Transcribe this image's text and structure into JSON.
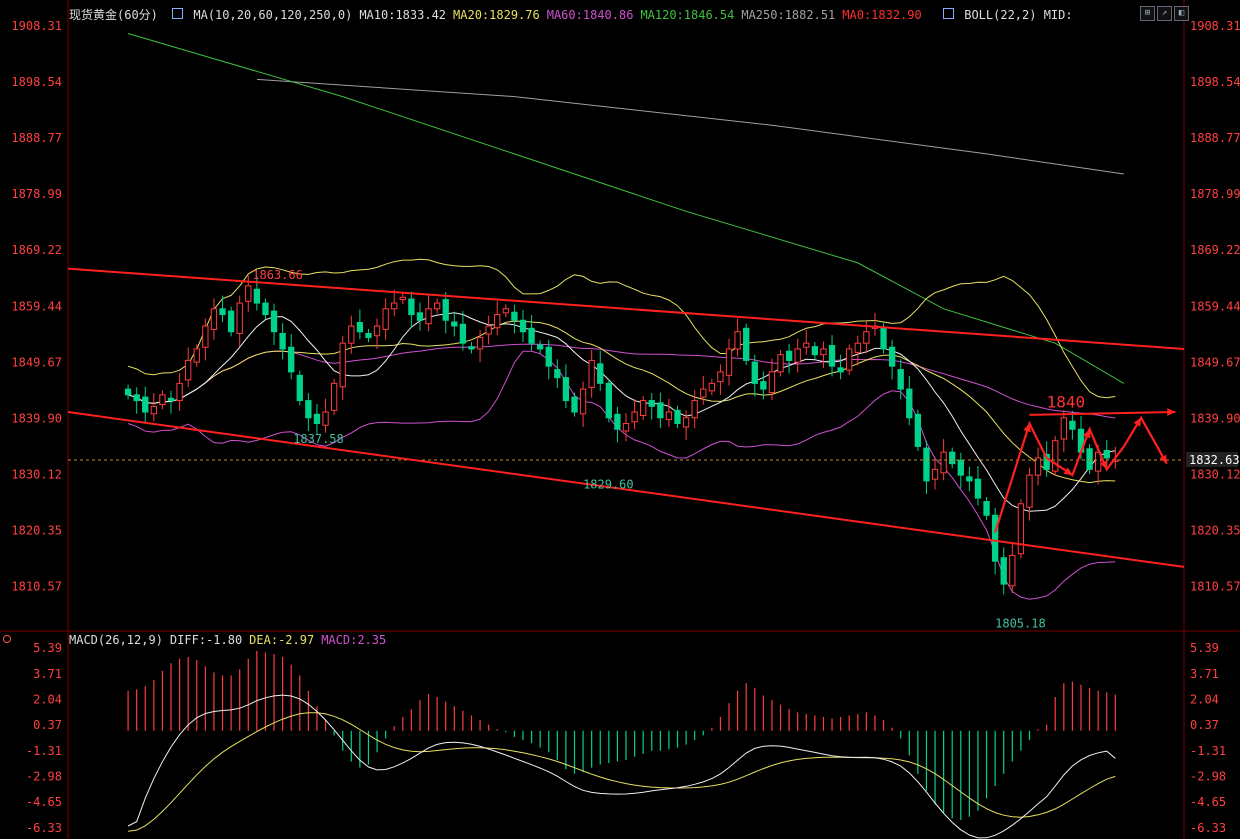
{
  "header": {
    "instrument": "现货黄金(60分)",
    "ma": [
      {
        "text": "MA(10,20,60,120,250,0)",
        "color": "#dddddd"
      },
      {
        "text": "MA10:1833.42",
        "color": "#dddddd"
      },
      {
        "text": "MA20:1829.76",
        "color": "#e8e060"
      },
      {
        "text": "MA60:1840.86",
        "color": "#d050d0"
      },
      {
        "text": "MA120:1846.54",
        "color": "#40c040"
      },
      {
        "text": "MA250:1882.51",
        "color": "#a0a0a0"
      },
      {
        "text": "MA0:1832.90",
        "color": "#ff3030"
      }
    ],
    "boll": "BOLL(22,2) MID:",
    "macd": [
      {
        "text": "MACD(26,12,9)",
        "color": "#dddddd"
      },
      {
        "text": "DIFF:-1.80",
        "color": "#dddddd"
      },
      {
        "text": "DEA:-2.97",
        "color": "#e8e060"
      },
      {
        "text": "MACD:2.35",
        "color": "#d050d0"
      }
    ]
  },
  "icons": {
    "instrument": "chart-icon",
    "boll": "chart-icon",
    "toolbar": [
      "candlestick-icon",
      "line-chart-icon",
      "split-icon"
    ],
    "macd": "indicator-dot-icon"
  },
  "colors": {
    "up": "#ff3c3c",
    "down": "#00d28c",
    "axis": "#ff4040",
    "ma10": "#f0f0f0",
    "ma20": "#e8e060",
    "ma60": "#d050d0",
    "ma120": "#40c040",
    "ma250": "#a0a0a0",
    "trend": "#ff2020"
  },
  "chart_data": [
    {
      "type": "candlestick",
      "ylim": [
        1803,
        1909
      ],
      "y_ticks": [
        "1908.31",
        "1898.54",
        "1888.77",
        "1878.99",
        "1869.22",
        "1859.44",
        "1849.67",
        "1839.90",
        "1830.12",
        "1820.35",
        "1810.57"
      ],
      "current_price": "1832.63",
      "close": [
        1844,
        1843,
        1841,
        1842,
        1844,
        1843,
        1846,
        1850,
        1852,
        1856,
        1859,
        1858,
        1855,
        1860,
        1863,
        1860,
        1858,
        1855,
        1852,
        1848,
        1843,
        1840,
        1839,
        1841,
        1846,
        1853,
        1856,
        1855,
        1854,
        1856,
        1859,
        1860,
        1861,
        1858,
        1857,
        1859,
        1860,
        1857,
        1856,
        1853,
        1852,
        1854,
        1856,
        1858,
        1859,
        1857,
        1855,
        1853,
        1852,
        1849,
        1847,
        1843,
        1841,
        1845,
        1850,
        1846,
        1840,
        1838,
        1839,
        1841,
        1843,
        1842,
        1840,
        1841,
        1839,
        1840,
        1843,
        1845,
        1846,
        1848,
        1852,
        1855,
        1850,
        1846,
        1845,
        1848,
        1851,
        1850,
        1852,
        1853,
        1851,
        1852,
        1849,
        1848,
        1852,
        1853,
        1855,
        1856,
        1852,
        1849,
        1845,
        1840,
        1835,
        1829,
        1831,
        1834,
        1832,
        1830,
        1829,
        1826,
        1823,
        1815,
        1811,
        1816,
        1825,
        1830,
        1833,
        1831,
        1836,
        1840,
        1838,
        1834,
        1831,
        1834,
        1833,
        1832.63
      ],
      "labels": [
        "1863.66",
        "1837.58",
        "1829.60",
        "1805.18",
        "1840"
      ],
      "series": [
        {
          "name": "MA10",
          "color": "#f0f0f0"
        },
        {
          "name": "MA20",
          "color": "#e8e060"
        },
        {
          "name": "MA60",
          "color": "#d050d0"
        },
        {
          "name": "MA120",
          "color": "#40c040"
        },
        {
          "name": "MA250",
          "color": "#a0a0a0"
        }
      ],
      "ma120_path": [
        [
          0,
          1907
        ],
        [
          25,
          1896
        ],
        [
          45,
          1886
        ],
        [
          65,
          1876
        ],
        [
          85,
          1867
        ],
        [
          95,
          1859
        ],
        [
          108,
          1853
        ],
        [
          116,
          1846
        ]
      ],
      "ma250_path": [
        [
          15,
          1899
        ],
        [
          45,
          1896
        ],
        [
          75,
          1891
        ],
        [
          100,
          1886
        ],
        [
          116,
          1882.5
        ]
      ],
      "trendlines": [
        {
          "from": [
            -7,
            1866
          ],
          "to": [
            123,
            1852
          ]
        },
        {
          "from": [
            -7,
            1841
          ],
          "to": [
            123,
            1814
          ]
        }
      ]
    },
    {
      "type": "bar",
      "ylim": [
        -6.33,
        5.39
      ],
      "y_ticks": [
        "5.39",
        "3.71",
        "2.04",
        "0.37",
        "-1.31",
        "-2.98",
        "-4.65",
        "-6.33"
      ],
      "macd_bars": [
        2.6,
        2.7,
        2.9,
        3.3,
        3.9,
        4.4,
        4.7,
        4.8,
        4.6,
        4.2,
        3.8,
        3.6,
        3.6,
        4.0,
        4.7,
        5.2,
        5.1,
        5.0,
        4.8,
        4.3,
        3.6,
        2.6,
        1.6,
        0.7,
        -0.3,
        -1.3,
        -2.0,
        -2.4,
        -2.2,
        -1.4,
        -0.5,
        0.3,
        0.9,
        1.4,
        2.0,
        2.4,
        2.2,
        1.9,
        1.6,
        1.3,
        1.0,
        0.7,
        0.4,
        0.1,
        -0.1,
        -0.4,
        -0.6,
        -0.8,
        -1.1,
        -1.4,
        -1.9,
        -2.5,
        -2.8,
        -2.7,
        -2.4,
        -2.2,
        -2.1,
        -2.0,
        -1.9,
        -1.7,
        -1.5,
        -1.3,
        -1.3,
        -1.2,
        -1.1,
        -0.9,
        -0.6,
        -0.3,
        0.2,
        0.9,
        1.8,
        2.6,
        3.1,
        2.8,
        2.3,
        2.0,
        1.7,
        1.4,
        1.2,
        1.1,
        1.0,
        0.9,
        0.8,
        0.9,
        1.0,
        1.1,
        1.2,
        1.0,
        0.7,
        0.2,
        -0.5,
        -1.6,
        -2.8,
        -3.9,
        -4.8,
        -5.4,
        -5.7,
        -5.8,
        -5.6,
        -5.2,
        -4.4,
        -3.6,
        -2.8,
        -2.0,
        -1.3,
        -0.6,
        0.1,
        0.4,
        2.2,
        3.1,
        3.2,
        3.0,
        2.8,
        2.6,
        2.5,
        2.35
      ],
      "series": [
        {
          "name": "DIFF",
          "color": "#f0f0f0"
        },
        {
          "name": "DEA",
          "color": "#e8e060"
        }
      ]
    }
  ]
}
